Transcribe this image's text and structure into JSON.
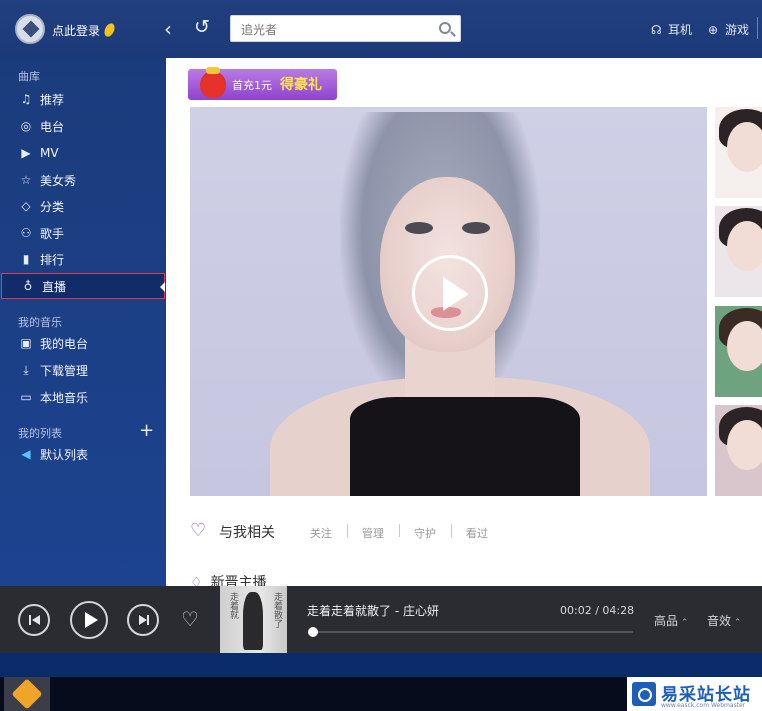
{
  "header": {
    "login_label": "点此登录",
    "search_value": "",
    "search_placeholder": "追光者",
    "links": [
      {
        "label": "耳机",
        "icon": "headphones-icon"
      },
      {
        "label": "游戏",
        "icon": "gamepad-icon"
      }
    ]
  },
  "sidebar": {
    "section_library": "曲库",
    "library_items": [
      {
        "label": "推荐",
        "icon": "music-note-icon"
      },
      {
        "label": "电台",
        "icon": "radio-icon"
      },
      {
        "label": "MV",
        "icon": "video-icon"
      },
      {
        "label": "美女秀",
        "icon": "star-icon"
      },
      {
        "label": "分类",
        "icon": "tag-icon"
      },
      {
        "label": "歌手",
        "icon": "person-icon"
      },
      {
        "label": "排行",
        "icon": "bar-chart-icon"
      },
      {
        "label": "直播",
        "icon": "microphone-icon",
        "active": true
      }
    ],
    "section_my_music": "我的音乐",
    "my_music_items": [
      {
        "label": "我的电台",
        "icon": "my-radio-icon"
      },
      {
        "label": "下载管理",
        "icon": "download-icon"
      },
      {
        "label": "本地音乐",
        "icon": "monitor-icon"
      }
    ],
    "section_my_lists": "我的列表",
    "list_items": [
      {
        "label": "默认列表",
        "icon": "speaker-icon"
      }
    ]
  },
  "main": {
    "promo": {
      "text": "首充1元",
      "highlight": "得豪礼"
    },
    "interest": {
      "title": "与我相关",
      "tabs": [
        "关注",
        "管理",
        "守护",
        "看过"
      ]
    },
    "new_section_title": "新晋主播"
  },
  "player": {
    "song_title": "走着走着就散了 - 庄心妍",
    "time_current": "00:02",
    "time_total": "04:28",
    "time_display": "00:02 / 04:28",
    "progress": 0.0075,
    "quality_label": "高品",
    "effect_label": "音效",
    "album_text_left": "走着就",
    "album_text_right": "走着散了"
  },
  "watermark": {
    "title": "易采站长站",
    "subtitle": "www.easck.com  Webmaster"
  }
}
